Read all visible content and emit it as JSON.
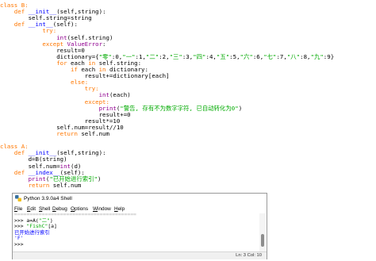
{
  "code": {
    "lines": [
      [
        {
          "t": "class B:",
          "c": "kw"
        }
      ],
      [
        {
          "t": "    def ",
          "c": "kw"
        },
        {
          "t": "__init__",
          "c": "df"
        },
        {
          "t": "(self,string):",
          "c": ""
        }
      ],
      [
        {
          "t": "        self.string=string",
          "c": ""
        }
      ],
      [
        {
          "t": "    def ",
          "c": "kw"
        },
        {
          "t": "__int__",
          "c": "df"
        },
        {
          "t": "(self):",
          "c": ""
        }
      ],
      [
        {
          "t": "            try:",
          "c": "kw"
        }
      ],
      [
        {
          "t": "                ",
          "c": ""
        },
        {
          "t": "int",
          "c": "bi"
        },
        {
          "t": "(self.string)",
          "c": ""
        }
      ],
      [
        {
          "t": "            except ",
          "c": "kw"
        },
        {
          "t": "ValueError",
          "c": "bi"
        },
        {
          "t": ":",
          "c": ""
        }
      ],
      [
        {
          "t": "                result=0",
          "c": ""
        }
      ],
      [
        {
          "t": "                dictionary={",
          "c": ""
        },
        {
          "t": "\"零\"",
          "c": "st"
        },
        {
          "t": ":0,",
          "c": ""
        },
        {
          "t": "\"一\"",
          "c": "st"
        },
        {
          "t": ":1,",
          "c": ""
        },
        {
          "t": "\"二\"",
          "c": "st"
        },
        {
          "t": ":2,",
          "c": ""
        },
        {
          "t": "\"三\"",
          "c": "st"
        },
        {
          "t": ":3,",
          "c": ""
        },
        {
          "t": "\"四\"",
          "c": "st"
        },
        {
          "t": ":4,",
          "c": ""
        },
        {
          "t": "\"五\"",
          "c": "st"
        },
        {
          "t": ":5,",
          "c": ""
        },
        {
          "t": "\"六\"",
          "c": "st"
        },
        {
          "t": ":6,",
          "c": ""
        },
        {
          "t": "\"七\"",
          "c": "st"
        },
        {
          "t": ":7,",
          "c": ""
        },
        {
          "t": "\"八\"",
          "c": "st"
        },
        {
          "t": ":8,",
          "c": ""
        },
        {
          "t": "\"九\"",
          "c": "st"
        },
        {
          "t": ":9}",
          "c": ""
        }
      ],
      [
        {
          "t": "                ",
          "c": ""
        },
        {
          "t": "for ",
          "c": "kw"
        },
        {
          "t": "each ",
          "c": ""
        },
        {
          "t": "in ",
          "c": "kw"
        },
        {
          "t": "self.string:",
          "c": ""
        }
      ],
      [
        {
          "t": "                    ",
          "c": ""
        },
        {
          "t": "if ",
          "c": "kw"
        },
        {
          "t": "each ",
          "c": ""
        },
        {
          "t": "in ",
          "c": "kw"
        },
        {
          "t": "dictionary:",
          "c": ""
        }
      ],
      [
        {
          "t": "                        result+=dictionary[each]",
          "c": ""
        }
      ],
      [
        {
          "t": "                    else:",
          "c": "kw"
        }
      ],
      [
        {
          "t": "                        try:",
          "c": "kw"
        }
      ],
      [
        {
          "t": "                            ",
          "c": ""
        },
        {
          "t": "int",
          "c": "bi"
        },
        {
          "t": "(each)",
          "c": ""
        }
      ],
      [
        {
          "t": "                        except:",
          "c": "kw"
        }
      ],
      [
        {
          "t": "                            ",
          "c": ""
        },
        {
          "t": "print",
          "c": "bi"
        },
        {
          "t": "(",
          "c": ""
        },
        {
          "t": "\"警告, 存有不为数字字符, 已自动转化为0\"",
          "c": "st"
        },
        {
          "t": ")",
          "c": ""
        }
      ],
      [
        {
          "t": "                            result+=0",
          "c": ""
        }
      ],
      [
        {
          "t": "                        result*=10",
          "c": ""
        }
      ],
      [
        {
          "t": "                self.num=result//10",
          "c": ""
        }
      ],
      [
        {
          "t": "                ",
          "c": ""
        },
        {
          "t": "return ",
          "c": "kw"
        },
        {
          "t": "self.num",
          "c": ""
        }
      ],
      [
        {
          "t": "",
          "c": ""
        }
      ],
      [
        {
          "t": "class A:",
          "c": "kw"
        }
      ],
      [
        {
          "t": "    def ",
          "c": "kw"
        },
        {
          "t": "__init__",
          "c": "df"
        },
        {
          "t": "(self,string):",
          "c": ""
        }
      ],
      [
        {
          "t": "        d=B(string)",
          "c": ""
        }
      ],
      [
        {
          "t": "        self.num=",
          "c": ""
        },
        {
          "t": "int",
          "c": "bi"
        },
        {
          "t": "(d)",
          "c": ""
        }
      ],
      [
        {
          "t": "    def ",
          "c": "kw"
        },
        {
          "t": "__index__",
          "c": "df"
        },
        {
          "t": "(self):",
          "c": ""
        }
      ],
      [
        {
          "t": "        ",
          "c": ""
        },
        {
          "t": "print",
          "c": "bi"
        },
        {
          "t": "(",
          "c": ""
        },
        {
          "t": "\"已开始进行索引\"",
          "c": "st"
        },
        {
          "t": ")",
          "c": ""
        }
      ],
      [
        {
          "t": "        ",
          "c": ""
        },
        {
          "t": "return ",
          "c": "kw"
        },
        {
          "t": "self.num",
          "c": ""
        }
      ]
    ]
  },
  "shell": {
    "title": "Python 3.9.0a4 Shell",
    "menus": [
      {
        "label": "File",
        "u": "F",
        "rest": "ile"
      },
      {
        "label": "Edit",
        "u": "E",
        "rest": "dit"
      },
      {
        "label": "Shell",
        "u": "S",
        "rest": "hell"
      },
      {
        "label": "Debug",
        "u": "D",
        "rest": "ebug"
      },
      {
        "label": "Options",
        "u": "O",
        "rest": "ptions"
      },
      {
        "label": "Window",
        "u": "W",
        "rest": "indow"
      },
      {
        "label": "Help",
        "u": "H",
        "rest": "elp"
      }
    ],
    "lines": [
      [
        {
          "t": "========================================",
          "c": "stw"
        }
      ],
      [
        {
          "t": ">>> a=A(",
          "c": ""
        },
        {
          "t": "\"二\"",
          "c": "st"
        },
        {
          "t": ")",
          "c": ""
        }
      ],
      [
        {
          "t": ">>> ",
          "c": ""
        },
        {
          "t": "\"FishC\"",
          "c": "st"
        },
        {
          "t": "[a]",
          "c": ""
        }
      ],
      [
        {
          "t": "已开始进行索引",
          "c": "df"
        }
      ],
      [
        {
          "t": "'F'",
          "c": "df"
        }
      ],
      [
        {
          "t": ">>> ",
          "c": ""
        }
      ]
    ],
    "status": "Ln: 3  Col: 10"
  }
}
